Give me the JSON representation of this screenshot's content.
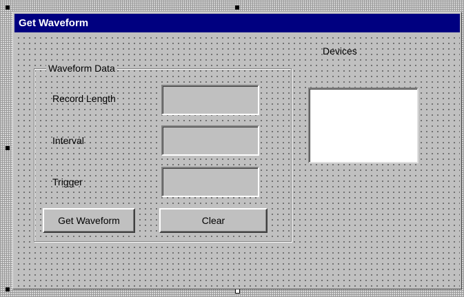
{
  "window": {
    "title": "Get Waveform"
  },
  "group": {
    "caption": "Waveform Data",
    "fields": [
      {
        "label": "Record Length",
        "value": ""
      },
      {
        "label": "Interval",
        "value": ""
      },
      {
        "label": "Trigger",
        "value": ""
      }
    ]
  },
  "buttons": {
    "get_waveform": "Get Waveform",
    "clear": "Clear"
  },
  "devices": {
    "label": "Devices",
    "items": []
  },
  "colors": {
    "title_bar": "#000080",
    "face": "#c0c0c0"
  }
}
